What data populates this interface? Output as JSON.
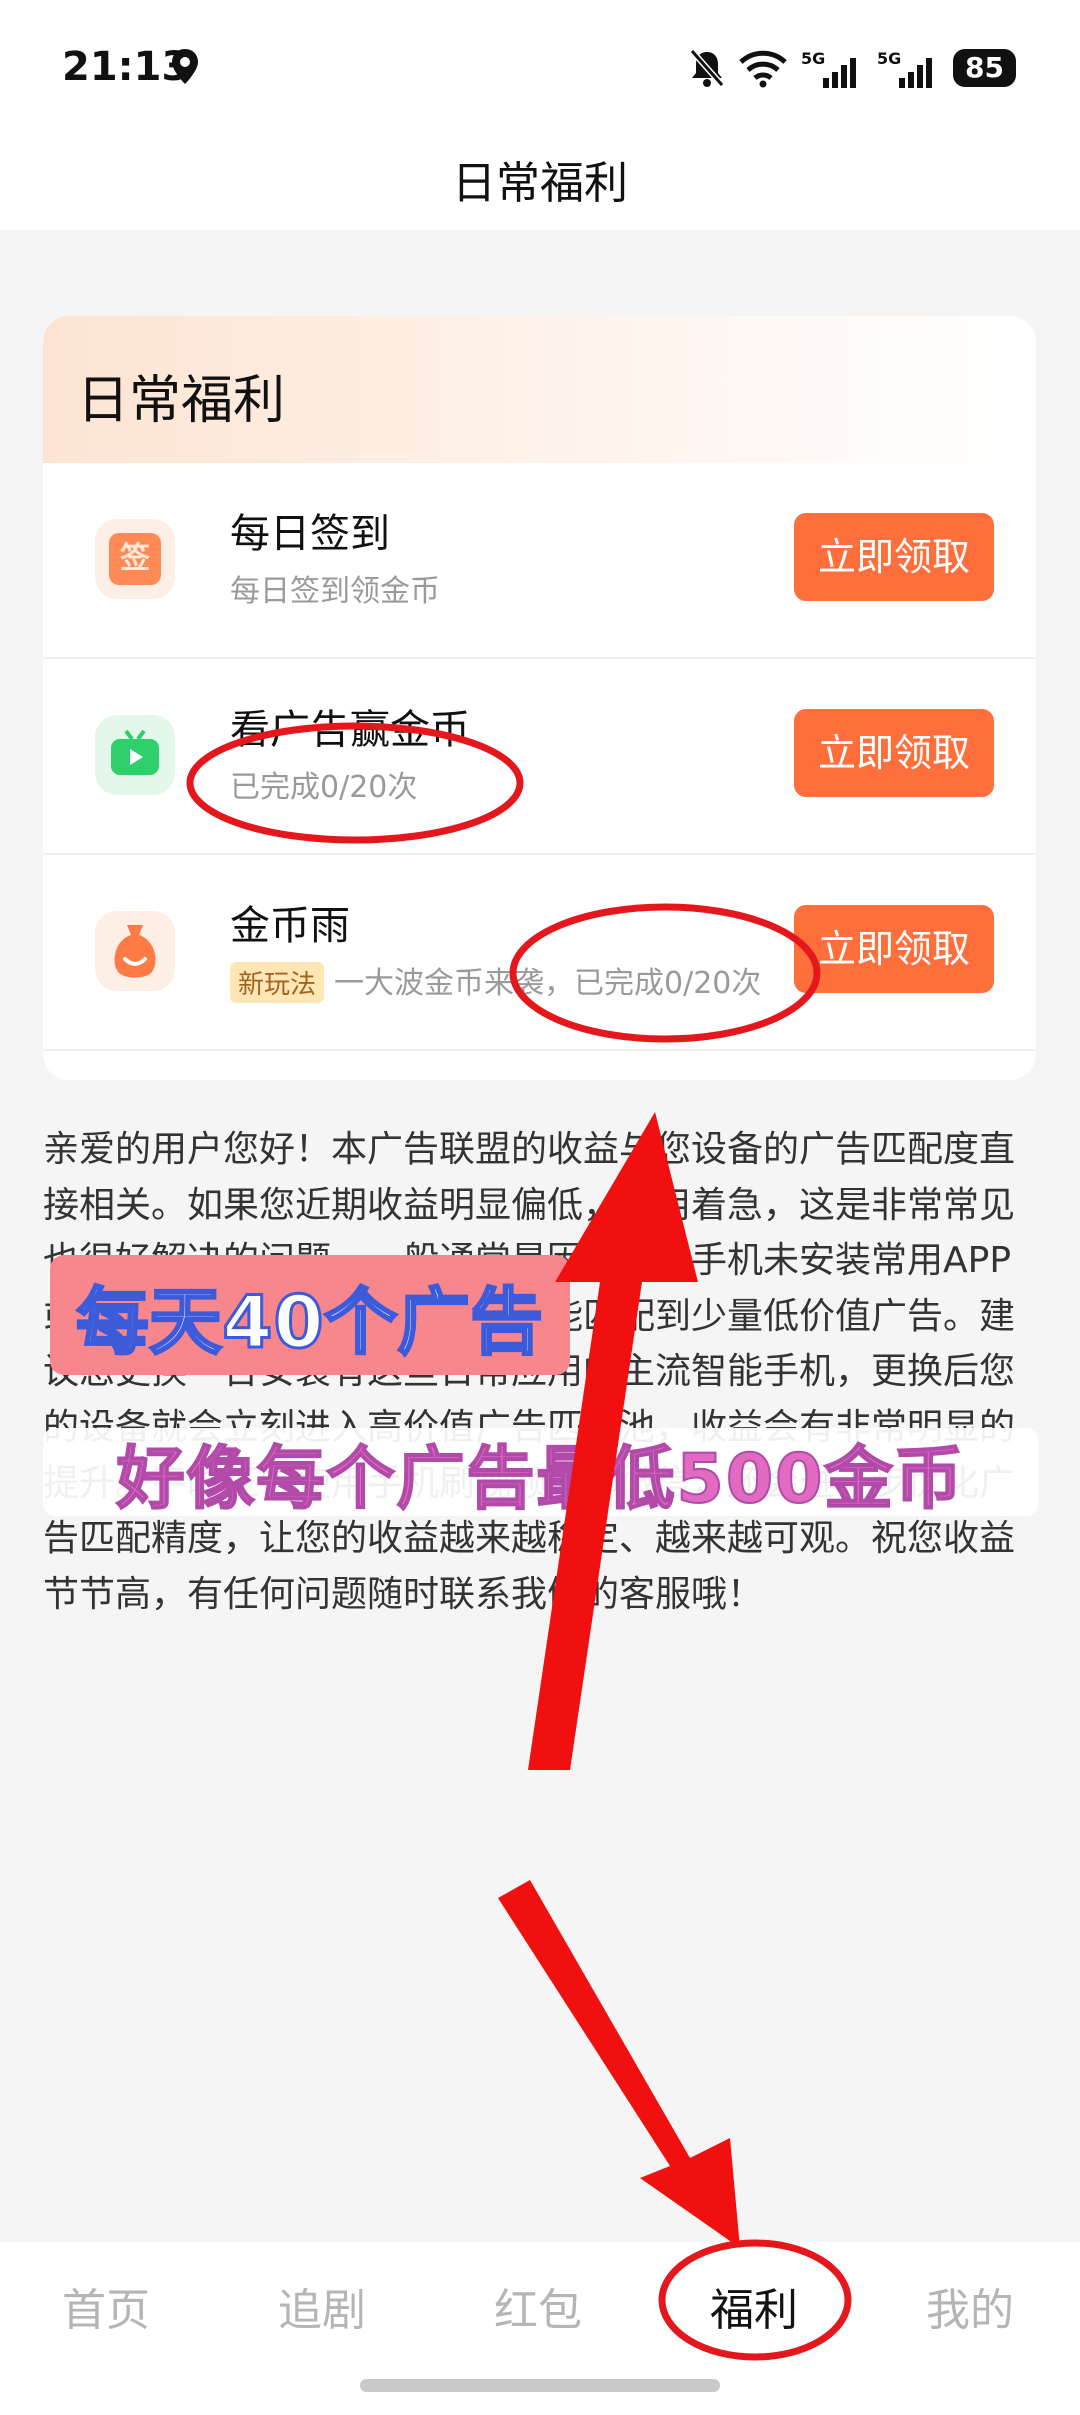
{
  "status_bar": {
    "time": "21:13",
    "network_label": "5G",
    "battery": "85"
  },
  "header": {
    "title": "日常福利"
  },
  "card": {
    "title": "日常福利",
    "rows": [
      {
        "icon": "sign-in-icon",
        "icon_char": "签",
        "name": "每日签到",
        "sub": "每日签到领金币",
        "tag": "",
        "button": "立即领取"
      },
      {
        "icon": "tv-play-icon",
        "name": "看广告赢金币",
        "sub": "已完成0/20次",
        "tag": "",
        "button": "立即领取"
      },
      {
        "icon": "money-bag-icon",
        "name": "金币雨",
        "sub": "一大波金币来袭，已完成0/20次",
        "tag": "新玩法",
        "button": "立即领取"
      }
    ]
  },
  "notice": "亲爱的用户您好！本广告联盟的收益与您设备的广告匹配度直接相关。如果您近期收益明显偏低，不用着急，这是非常常见也很好解决的问题。一般通常是因为您的手机未安装常用APP或长期未使用常用软件，导致只能匹配到少量低价值广告。建议您更换一台安装有这些日常应用的主流智能手机，更换后您的设备就会立刻进入高价值广告匹配池，收益会有非常明显的提升。平时正常使用手机刷视频、聊微信，还会进一步优化广告匹配精度，让您的收益越来越稳定、越来越可观。祝您收益节节高，有任何问题随时联系我们的客服哦！",
  "overlays": {
    "caption1": "每天40个广告",
    "caption2": "好像每个广告最低500金币"
  },
  "nav": {
    "items": [
      "首页",
      "追剧",
      "红包",
      "福利",
      "我的"
    ],
    "active": "福利"
  },
  "colors": {
    "accent": "#ff6f3c",
    "annotation": "#e3171c"
  }
}
